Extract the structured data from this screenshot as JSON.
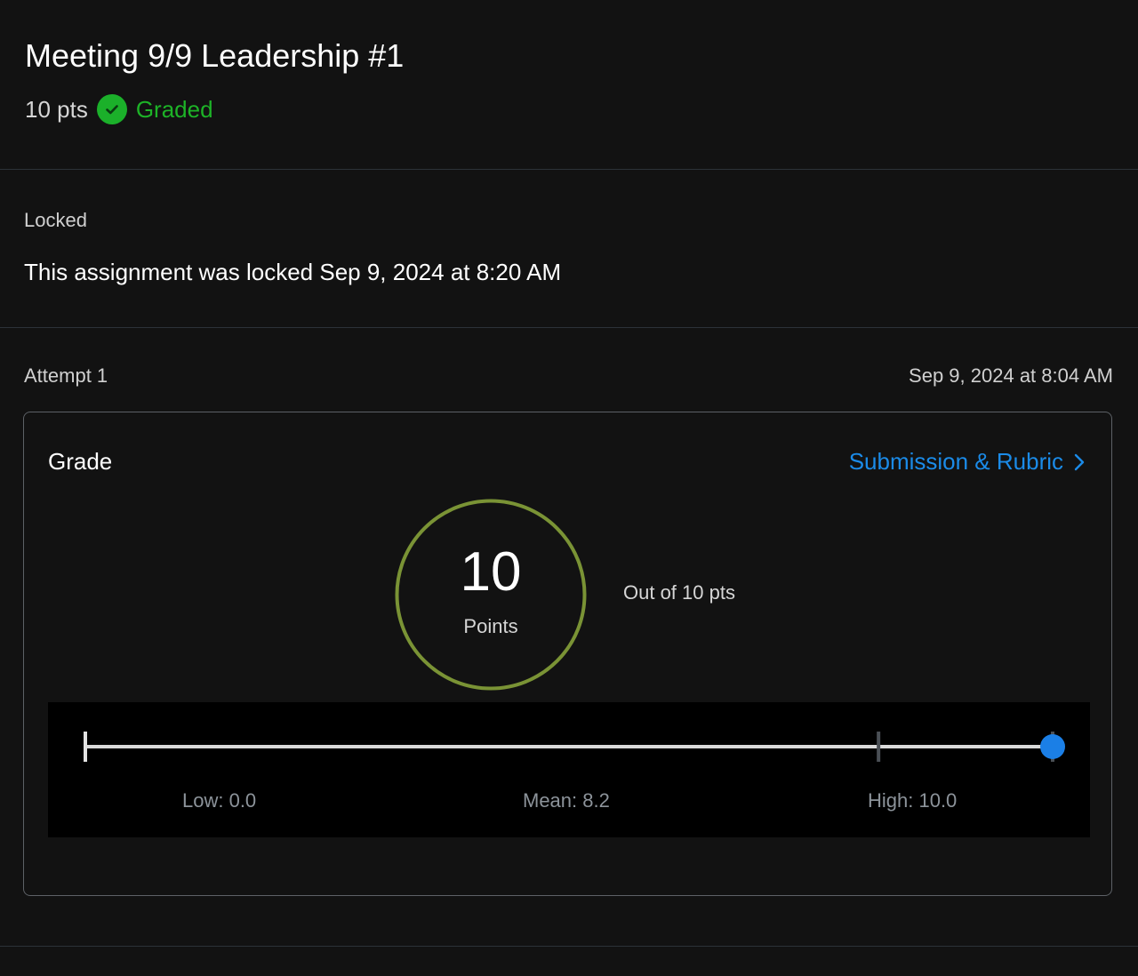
{
  "assignment": {
    "title": "Meeting 9/9 Leadership #1",
    "points": "10 pts",
    "status": "Graded",
    "status_icon": "check-circle-icon",
    "status_color": "#1db327"
  },
  "lock": {
    "label": "Locked",
    "message": "This assignment was locked Sep 9, 2024 at 8:20 AM"
  },
  "attempt": {
    "label": "Attempt 1",
    "date": "Sep 9, 2024 at 8:04 AM"
  },
  "grade": {
    "title": "Grade",
    "link_label": "Submission & Rubric",
    "link_icon": "chevron-right-icon",
    "link_color": "#1b8be8",
    "score": "10",
    "score_unit": "Points",
    "out_of": "Out of 10 pts",
    "ring_color": "#7a9335"
  },
  "stats": {
    "low_label": "Low: 0.0",
    "mean_label": "Mean: 8.2",
    "high_label": "High: 10.0",
    "low": 0.0,
    "mean": 8.2,
    "high": 10.0,
    "score": 10,
    "marker_color": "#1b7fe6"
  }
}
